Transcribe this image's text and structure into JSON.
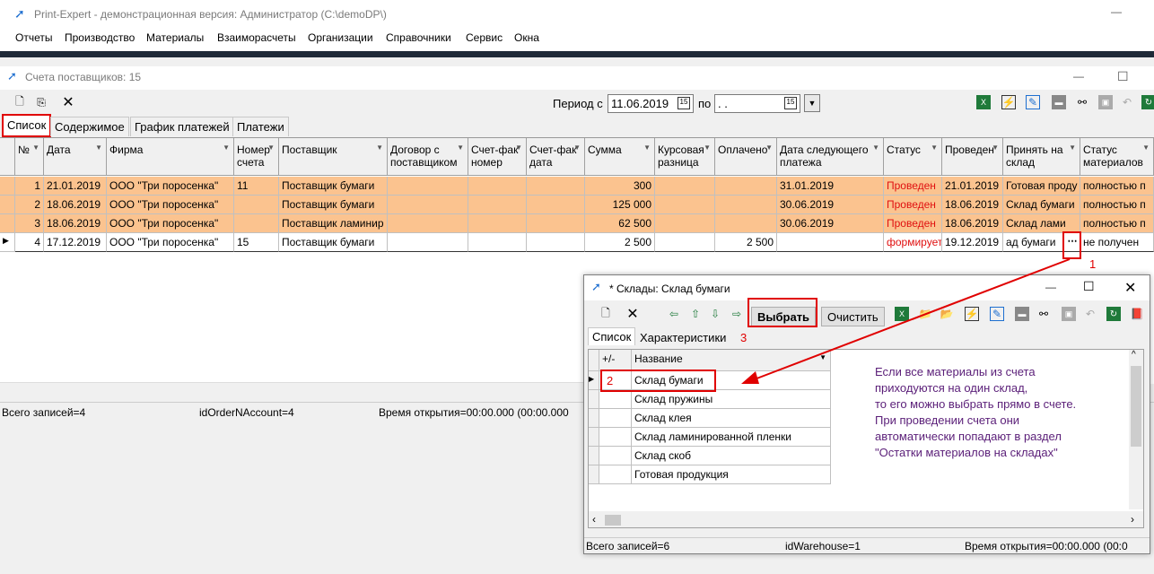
{
  "app": {
    "title": "Print-Expert - демонстрационная версия: Администратор (C:\\demoDP\\)",
    "min": "—"
  },
  "menu": [
    "Отчеты",
    "Производство",
    "Материалы",
    "Взаиморасчеты",
    "Организации",
    "Справочники",
    "Сервис",
    "Окна"
  ],
  "doc": {
    "title": "Счета поставщиков: 15",
    "period_label": "Период с",
    "date_from": "11.06.2019",
    "to_label": "по",
    "date_to": " .  .",
    "min": "—",
    "max": "☐"
  },
  "tabs": [
    "Список",
    "Содержимое",
    "График платежей",
    "Платежи"
  ],
  "columns": [
    "№",
    "Дата",
    "Фирма",
    "Номер счета",
    "Поставщик",
    "Договор с поставщиком",
    "Счет-фактура номер",
    "Счет-фактура дата",
    "Сумма",
    "Курсовая разница",
    "Оплачено",
    "Дата следующего платежа",
    "Статус",
    "Проведен",
    "Принять на склад",
    "Статус материалов"
  ],
  "column_headers_visible": [
    "№",
    "Дата",
    "Фирма",
    "Номер\nсчета",
    "Поставщик",
    "Договор с\nпоставщиком",
    "Счет-фак\nномер",
    "Счет-фак\nдата",
    "Сумма",
    "Курсовая\nразница",
    "Оплачено",
    "Дата следующего\nплатежа",
    "Статус",
    "Проведен",
    "Принять на\nсклад",
    "Статус\nматериалов"
  ],
  "rows": [
    {
      "n": "1",
      "date": "21.01.2019",
      "firm": "ООО \"Три поросенка\"",
      "num": "11",
      "supplier": "Поставщик бумаги",
      "contract": "",
      "sfn": "",
      "sfd": "",
      "sum": "300",
      "kurs": "",
      "paid": "",
      "next": "31.01.2019",
      "status": "Проведен",
      "posted": "21.01.2019",
      "store": "Готовая проду",
      "mstatus": "полностью п"
    },
    {
      "n": "2",
      "date": "18.06.2019",
      "firm": "ООО \"Три поросенка\"",
      "num": "",
      "supplier": "Поставщик бумаги",
      "contract": "",
      "sfn": "",
      "sfd": "",
      "sum": "125 000",
      "kurs": "",
      "paid": "",
      "next": "30.06.2019",
      "status": "Проведен",
      "posted": "18.06.2019",
      "store": "Склад бумаги",
      "mstatus": "полностью п"
    },
    {
      "n": "3",
      "date": "18.06.2019",
      "firm": "ООО \"Три поросенка\"",
      "num": "",
      "supplier": "Поставщик ламинир",
      "contract": "",
      "sfn": "",
      "sfd": "",
      "sum": "62 500",
      "kurs": "",
      "paid": "",
      "next": "30.06.2019",
      "status": "Проведен",
      "posted": "18.06.2019",
      "store": "Склад лами",
      "mstatus": "полностью п"
    },
    {
      "n": "4",
      "date": "17.12.2019",
      "firm": "ООО \"Три поросенка\"",
      "num": "15",
      "supplier": "Поставщик бумаги",
      "contract": "",
      "sfn": "",
      "sfd": "",
      "sum": "2 500",
      "kurs": "",
      "paid": "2 500",
      "next": "",
      "status": "формирует",
      "posted": "19.12.2019",
      "store": "ад бумаги",
      "mstatus": "не получен"
    }
  ],
  "status_bar": {
    "records": "Всего записей=4",
    "id": "idOrderNAccount=4",
    "time": "Время открытия=00:00.000 (00:00.000"
  },
  "dialog": {
    "title": "* Склады: Склад бумаги",
    "select": "Выбрать",
    "clear": "Очистить",
    "tabs": [
      "Список",
      "Характеристики"
    ],
    "col_pm": "+/-",
    "col_name": "Название",
    "items": [
      "Склад бумаги",
      "Склад пружины",
      "Склад клея",
      "Склад ламинированной пленки",
      "Склад скоб",
      "Готовая продукция"
    ],
    "records": "Всего записей=6",
    "id": "idWarehouse=1",
    "time": "Время открытия=00:00.000 (00:0"
  },
  "annotations": {
    "n1": "1",
    "n2": "2",
    "n3": "3",
    "note": [
      "Если все материалы из счета",
      "приходуются на один склад,",
      "то его можно выбрать прямо в счете.",
      "При проведении счета они",
      "автоматически попадают в раздел",
      "\"Остатки материалов на складах\""
    ]
  },
  "colors": {
    "row_posted": "#fbc38f",
    "status_red": "#e01010",
    "annotation": "#e00000",
    "note": "#5a1e78"
  }
}
